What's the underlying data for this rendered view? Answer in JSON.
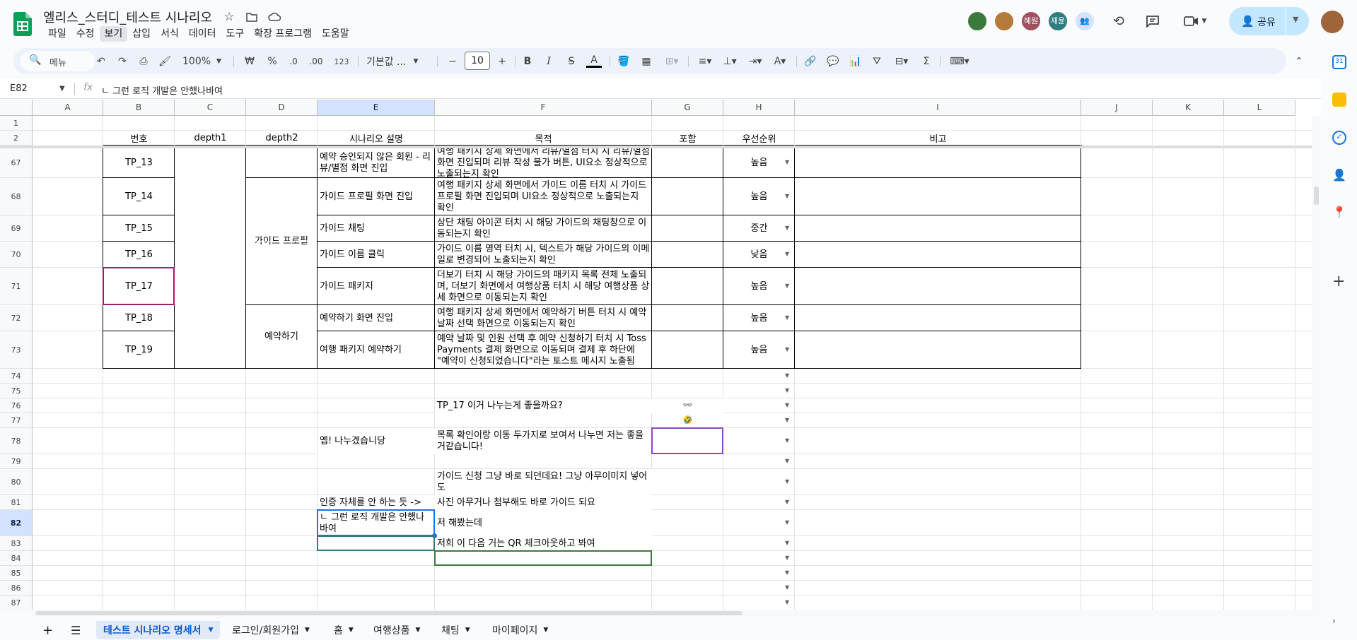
{
  "app": {
    "doc_title": "엘리스_스터디_테스트 시나리오",
    "menus": [
      "파일",
      "수정",
      "보기",
      "삽입",
      "서식",
      "데이터",
      "도구",
      "확장 프로그램",
      "도움말"
    ],
    "selected_menu": "보기",
    "share_label": "공유",
    "collaborators": [
      {
        "name": "",
        "color": "#3c7a3c"
      },
      {
        "name": "",
        "color": "#b57b3a"
      },
      {
        "name": "혜원",
        "color": "#a0505f"
      },
      {
        "name": "재윤",
        "color": "#2f7d7d"
      }
    ]
  },
  "toolbar": {
    "search_label": "메뉴",
    "zoom": "100%",
    "currency": "₩",
    "percent": "%",
    "dec_less": ".0",
    "dec_more": ".00",
    "number_format": "123",
    "font": "기본값 ...",
    "font_size": "10",
    "bold": "B",
    "italic": "I",
    "strike": "S",
    "text_color": "A"
  },
  "formula_bar": {
    "name_box": "E82",
    "fx": "fx",
    "content": "ㄴ 그런 로직 개발은 안했나바여"
  },
  "columns": [
    "A",
    "B",
    "C",
    "D",
    "E",
    "F",
    "G",
    "H",
    "I",
    "J",
    "K",
    "L"
  ],
  "selected_column": "E",
  "header_row": {
    "B": "번호",
    "C": "depth1",
    "D": "depth2",
    "E": "시나리오 설명",
    "F": "목적",
    "G": "포함",
    "H": "우선순위",
    "I": "비고"
  },
  "rows": [
    {
      "num": "67",
      "B": "TP_13",
      "E": "예약 승인되지 않은 회원 - 리뷰/별점 화면 진입",
      "F": "여행 패키지 상세 화면에서 리뷰/별점 터치 시 리뷰/별점 화면 진입되며 리뷰 작성 불가 버튼, UI요소 정상적으로 노출되는지 확인",
      "H": "높음"
    },
    {
      "num": "68",
      "B": "TP_14",
      "E": "가이드 프로필 화면 진입",
      "F": "여행 패키지 상세 화면에서 가이드 이름 터치 시 가이드 프로필 화면 진입되며 UI요소 정상적으로 노출되는지 확인",
      "H": "높음"
    },
    {
      "num": "69",
      "B": "TP_15",
      "E": "가이드 채팅",
      "F": "상단 채팅 아이콘 터치 시 해당 가이드의 채팅창으로 이동되는지 확인",
      "H": "중간"
    },
    {
      "num": "70",
      "B": "TP_16",
      "E": "가이드 이름 클릭",
      "F": "가이드 이름 영역 터치 시, 텍스트가 해당 가이드의 이메일로 변경되어 노출되는지 확인",
      "H": "낮음"
    },
    {
      "num": "71",
      "B": "TP_17",
      "E": "가이드 패키지",
      "F": "더보기 터치 시 해당 가이드의 패키지 목록 전체 노출되며, 더보기 화면에서 여행상품 터치 시 해당 여행상품 상세 화면으로 이동되는지 확인",
      "H": "높음"
    },
    {
      "num": "72",
      "B": "TP_18",
      "E": "예약하기 화면 진입",
      "F": "여행 패키지 상세 화면에서 예약하기 버튼 터치 시 예약 날짜 선택 화면으로 이동되는지 확인",
      "H": "높음"
    },
    {
      "num": "73",
      "B": "TP_19",
      "E": "여행 패키지 예약하기",
      "F": "예약 날짜 및 인원 선택 후 예약 신청하기 터치 시 Toss Payments 결제 화면으로 이동되며 결제 후 하단에 \"예약이 신청되었습니다\"라는 토스트 메시지 노출됨",
      "H": "높음"
    },
    {
      "num": "74"
    },
    {
      "num": "75"
    },
    {
      "num": "76",
      "F": "TP_17 이거 나누는게 좋을까요?",
      "G": "👓"
    },
    {
      "num": "77",
      "G": "🤣"
    },
    {
      "num": "78",
      "E": "옙! 나누겠습니당",
      "F": "목록 확인이랑 이동 두가지로 보여서 나누면 저는 좋을거같습니다!"
    },
    {
      "num": "79"
    },
    {
      "num": "80",
      "F": "가이드 신청 그냥 바로 되던데요! 그냥 아무이미지 넣어도"
    },
    {
      "num": "81",
      "E": "인증 자체를 안 하는 듯 ->",
      "F": "사진 아무거나 첨부해도 바로 가이드 되요"
    },
    {
      "num": "82",
      "E": "ㄴ 그런 로직 개발은 안했나바여",
      "F": "저 해봤는데"
    },
    {
      "num": "83",
      "F": "저희 이 다음 거는 QR 체크아웃하고 봐여"
    },
    {
      "num": "84"
    },
    {
      "num": "85"
    },
    {
      "num": "86"
    },
    {
      "num": "87"
    }
  ],
  "row1_num": "1",
  "row2_num": "2",
  "merged": {
    "D_guide_profile": "가이드 프로필",
    "D_reservation": "예약하기"
  },
  "tabs": [
    "테스트 시나리오 명세서",
    "로그인/회원가입",
    "홈",
    "여행상품",
    "채팅",
    "마이페이지"
  ],
  "active_tab": "테스트 시나리오 명세서"
}
